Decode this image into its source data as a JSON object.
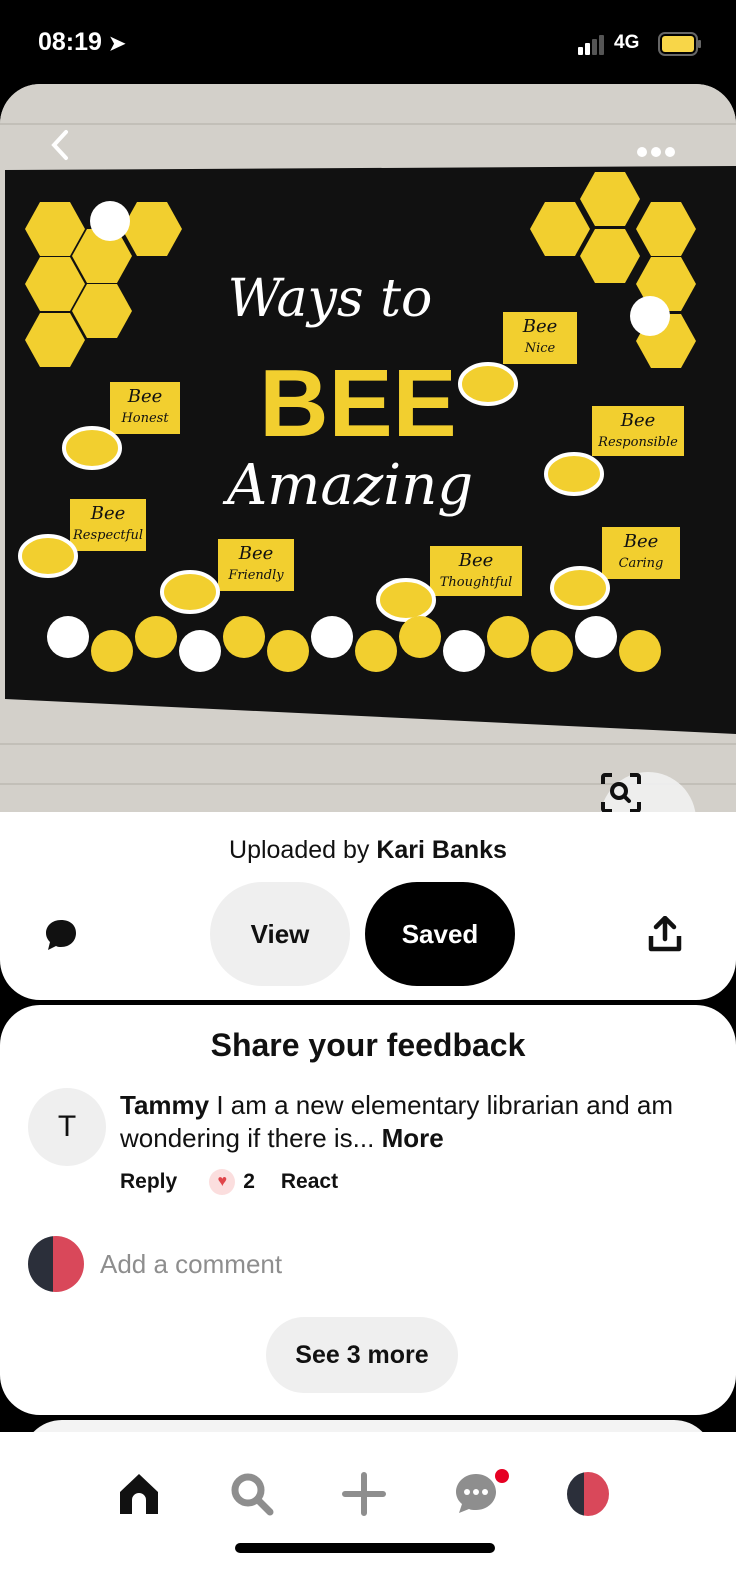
{
  "status_bar": {
    "time": "08:19",
    "network": "4G",
    "battery_color": "#f8d648"
  },
  "pin": {
    "board_text": {
      "line1": "Ways to",
      "line2": "BEE",
      "line3": "Amazing"
    },
    "bee_labels": [
      "Bee Nice",
      "Bee Honest",
      "Bee Responsible",
      "Bee Respectful",
      "Bee Friendly",
      "Bee Thoughtful",
      "Bee Caring"
    ],
    "uploaded_prefix": "Uploaded by ",
    "uploader": "Kari Banks"
  },
  "actions": {
    "view_label": "View",
    "saved_label": "Saved"
  },
  "feedback": {
    "title": "Share your feedback",
    "comment": {
      "avatar_letter": "T",
      "author": "Tammy",
      "text": " I am a new elementary librarian and am wondering if there is... ",
      "more_label": "More",
      "reply_label": "Reply",
      "reaction_count": "2",
      "react_label": "React"
    },
    "add_comment_placeholder": "Add a comment",
    "see_more_label": "See 3 more"
  },
  "nav": {
    "items": [
      "home",
      "search",
      "create",
      "messages",
      "profile"
    ],
    "notification_color": "#e60023"
  }
}
